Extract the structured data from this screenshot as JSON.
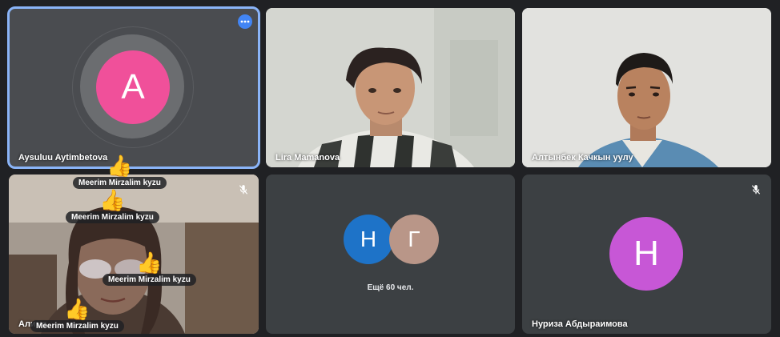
{
  "participants": [
    {
      "name": "Aysuluu Aytimbetova",
      "initial": "A",
      "avatar_color": "#f0509a"
    },
    {
      "name": "Lira Mamanova"
    },
    {
      "name": "Алтынбек Качкын уулу"
    },
    {
      "name": "Алима",
      "muted": true
    },
    {
      "name": "Нуриза Абдыраимова",
      "initial": "Н",
      "avatar_color": "#c757d6",
      "muted": true
    }
  ],
  "others": {
    "avatars": [
      {
        "initial": "Н",
        "color": "#1e73c8"
      },
      {
        "initial": "Г",
        "color": "#b99688"
      }
    ],
    "label": "Ещё 60 чел."
  },
  "reactions": [
    {
      "emoji": "👍",
      "name": "Meerim Mirzalim kyzu"
    },
    {
      "emoji": "👍",
      "name": "Meerim Mirzalim kyzu"
    },
    {
      "emoji": "👍",
      "name": "Meerim Mirzalim kyzu"
    },
    {
      "emoji": "👍",
      "name": "Meerim Mirzalim kyzu"
    }
  ],
  "colors": {
    "background": "#202124",
    "tile": "#3c4043",
    "active_border": "#8ab4f8"
  },
  "icons": {
    "more": "more-options-icon",
    "mute": "mic-off-icon"
  }
}
